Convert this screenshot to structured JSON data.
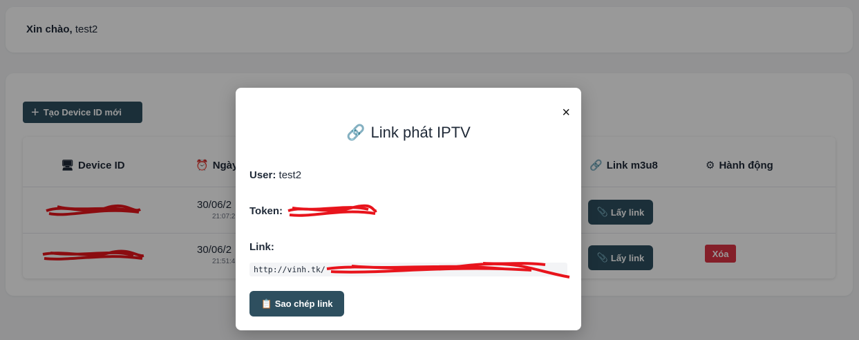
{
  "greeting": {
    "label": "Xin chào,",
    "username": "test2"
  },
  "toolbar": {
    "create_label": "Tạo Device ID mới",
    "create_icon": "+"
  },
  "table": {
    "headers": [
      {
        "icon": "🖥",
        "label": "Device ID"
      },
      {
        "icon": "⏰",
        "label": "Ngày"
      },
      {
        "icon": "🔗",
        "label": "Link m3u8"
      },
      {
        "icon": "⚙",
        "label": "Hành động"
      }
    ],
    "rows": [
      {
        "date": "30/06/2",
        "time": "21:07:2",
        "getlink_label": "Lấy link",
        "action": ""
      },
      {
        "date": "30/06/2",
        "time": "21:51:4",
        "getlink_label": "Lấy link",
        "action": "Xóa"
      }
    ]
  },
  "modal": {
    "close": "×",
    "title_icon": "🔗",
    "title": "Link phát IPTV",
    "user_label": "User:",
    "user_value": "test2",
    "token_label": "Token:",
    "link_label": "Link:",
    "link_value": "http://vinh.tk/",
    "copy_label": "Sao chép link",
    "copy_icon": "📋"
  },
  "colors": {
    "primary": "#2e4f5f",
    "danger": "#dc3545",
    "redaction": "#e8141c"
  }
}
